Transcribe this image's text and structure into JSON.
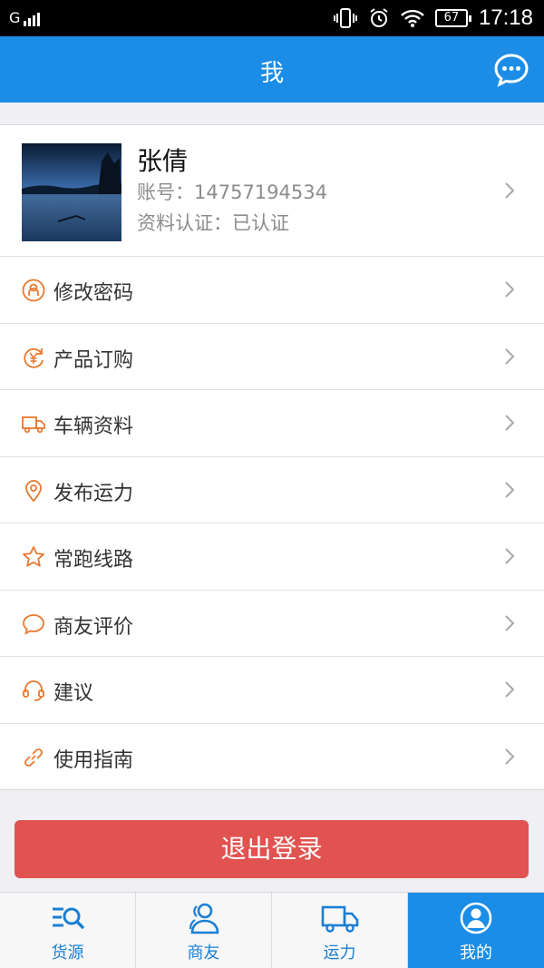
{
  "status_bar": {
    "signal": "G",
    "battery": "67",
    "time": "17:18"
  },
  "header": {
    "title": "我"
  },
  "profile": {
    "name": "张倩",
    "account_label": "账号：",
    "account": "14757194534",
    "verify_label": "资料认证：",
    "verify_status": "已认证"
  },
  "menu": {
    "items": [
      {
        "label": "修改密码",
        "icon": "user-lock-icon"
      },
      {
        "label": "产品订购",
        "icon": "yen-refresh-icon"
      },
      {
        "label": "车辆资料",
        "icon": "truck-icon"
      },
      {
        "label": "发布运力",
        "icon": "location-pin-icon"
      },
      {
        "label": "常跑线路",
        "icon": "star-icon"
      },
      {
        "label": "商友评价",
        "icon": "speech-bubble-icon"
      },
      {
        "label": "建议",
        "icon": "headset-icon"
      },
      {
        "label": "使用指南",
        "icon": "link-icon"
      }
    ]
  },
  "logout": {
    "label": "退出登录"
  },
  "tabs": [
    {
      "label": "货源",
      "icon": "list-search-icon"
    },
    {
      "label": "商友",
      "icon": "friends-icon"
    },
    {
      "label": "运力",
      "icon": "truck-outline-icon"
    },
    {
      "label": "我的",
      "icon": "person-circle-icon",
      "active": true
    }
  ],
  "colors": {
    "primary": "#1b8de6",
    "accent_icon": "#e8782f",
    "logout": "#e05350"
  }
}
